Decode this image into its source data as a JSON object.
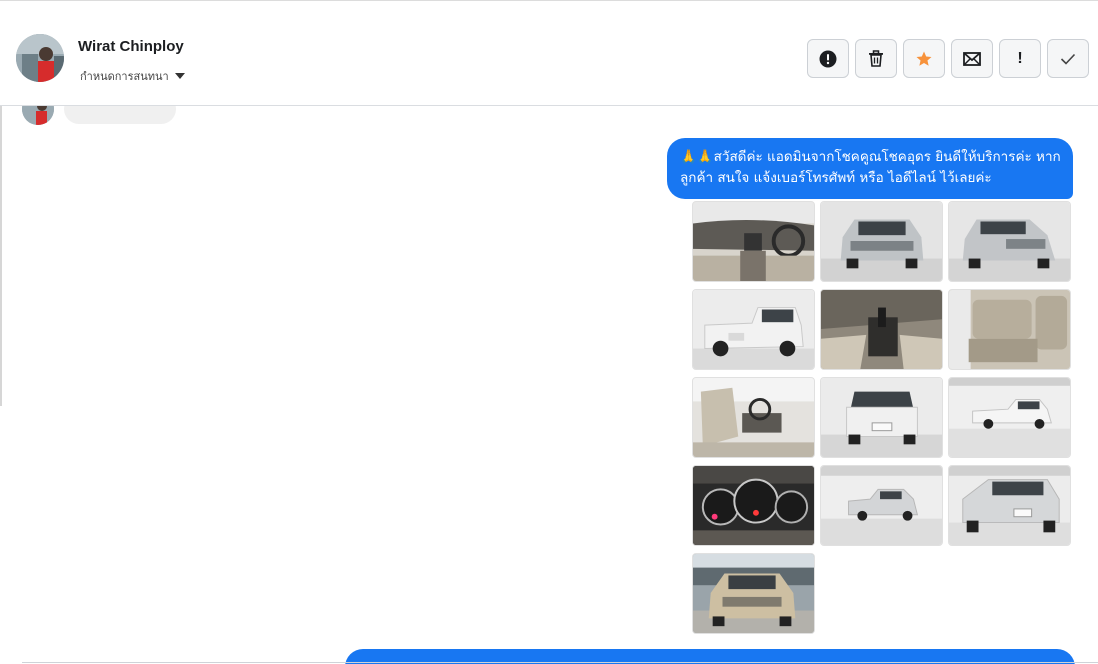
{
  "header": {
    "contact_name": "Wirat Chinploy",
    "conversation_setting": "กำหนดการสนทนา"
  },
  "toolbar": {
    "buttons": [
      {
        "name": "report-button",
        "icon": "alert-circle-icon"
      },
      {
        "name": "delete-button",
        "icon": "trash-icon"
      },
      {
        "name": "star-button",
        "icon": "star-icon",
        "color": "#f7923b"
      },
      {
        "name": "mark-unread-button",
        "icon": "envelope-icon"
      },
      {
        "name": "important-button",
        "icon": "exclamation-icon",
        "label": "!"
      },
      {
        "name": "done-button",
        "icon": "check-icon"
      }
    ]
  },
  "message": {
    "text": "🙏🙏สวัสดีค่ะ แอดมินจากโชคคูณโชคอุดร ยินดีให้บริการค่ะ หากลูกค้า สนใจ แจ้งเบอร์โทรศัพท์ หรือ ไอดีไลน์  ไว้เลยค่ะ",
    "bubble_color": "#1877f2"
  },
  "photos": [
    "interior-dashboard",
    "front-view",
    "front-view-angle",
    "rear-view-angle",
    "gear-console",
    "rear-seats",
    "front-seat-interior",
    "rear-view",
    "side-view",
    "instrument-cluster",
    "side-view-angle",
    "rear-view-angle-2",
    "outdoor-front-view"
  ]
}
